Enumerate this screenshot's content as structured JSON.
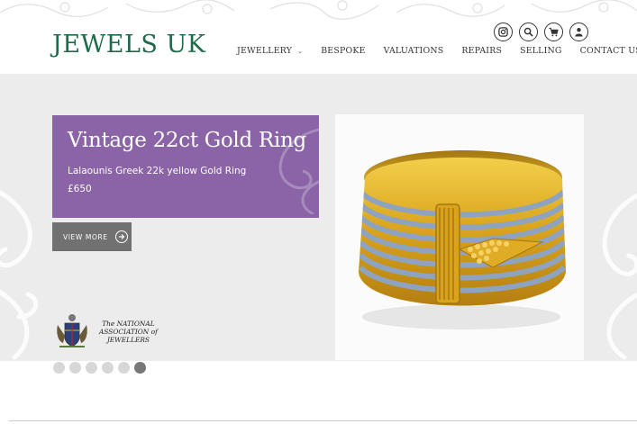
{
  "brand": {
    "logo": "JEWELS UK",
    "color": "#1f6a49"
  },
  "header_icons": [
    "instagram-icon",
    "search-icon",
    "cart-icon",
    "user-icon"
  ],
  "nav": {
    "items": [
      "JEWELLERY",
      "BESPOKE",
      "VALUATIONS",
      "REPAIRS",
      "SELLING",
      "CONTACT US"
    ],
    "dropdown_indicator": "⌄"
  },
  "slide": {
    "title": "Vintage 22ct Gold Ring",
    "subtitle": "Lalaounis Greek 22k yellow Gold Ring",
    "price": "£650",
    "cta": "VIEW MORE",
    "panel_color": "#8a64a6"
  },
  "association": {
    "line1": "The NATIONAL",
    "line2": "ASSOCIATION of",
    "line3": "JEWELLERS"
  },
  "carousel": {
    "count": 6,
    "active_index": 5
  }
}
